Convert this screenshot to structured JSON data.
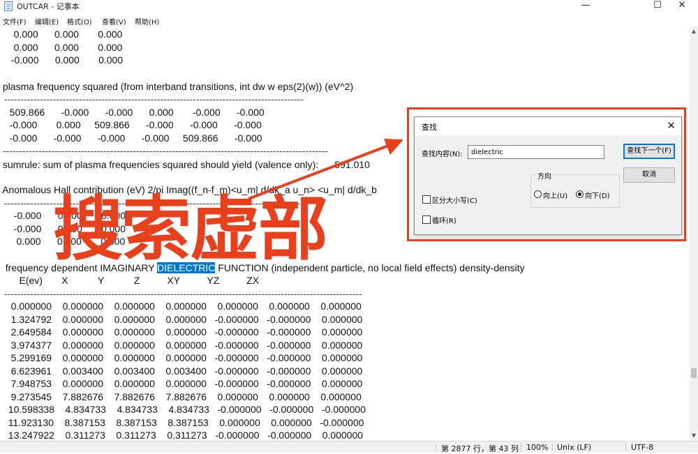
{
  "window": {
    "title": "OUTCAR - 记事本",
    "min": "—",
    "max": "☐",
    "close": "✕"
  },
  "menu": [
    "文件(F)",
    "编辑(E)",
    "格式(O)",
    "查看(V)",
    "帮助(H)"
  ],
  "lines": [
    "   0.000      0.000       0.000",
    "   0.000      0.000       0.000",
    "  -0.000      0.000       0.000",
    " plasma frequency squared (from interband transitions, int dw w eps(2)(w)) (eV^2)",
    " --------------------------------------------------------------------------------------------",
    "   509.866      -0.000      -0.000      0.000       -0.000      -0.000",
    "   -0.000       0.000     509.866      -0.000      -0.000      -0.000",
    "   -0.000      -0.000      -0.000      -0.000     509.866      -0.000",
    " ----------------------------------------------------------------------------------------------------",
    " sumrule: sum of plasma frequencies squared should yield (valence only):      591.010",
    " Anomalous Hall contribution (eV) 2/pi Imag((f_n-f_m)<u_m| d/dk_a u_n> <u_m| d/dk_b",
    " --------------------------------------------------------------------------------------------",
    "   -0.000      0.000       0.000",
    "   -0.000      0.000       0.000",
    "    0.000      0.000       0.000",
    "  frequency dependent IMAGINARY ",
    "DIELECTRIC",
    " FUNCTION (independent particle, no local field effects) density-density",
    "     E(ev)       X           Y           Z          XY          YZ          ZX",
    " --------------------------------------------------------------------------------------------------------------",
    "   0.000000    0.000000    0.000000    0.000000    0.000000    0.000000    0.000000",
    "   1.324792    0.000000    0.000000    0.000000   -0.000000   -0.000000    0.000000",
    "   2.649584    0.000000    0.000000    0.000000   -0.000000   -0.000000    0.000000",
    "   3.974377    0.000000    0.000000    0.000000   -0.000000   -0.000000    0.000000",
    "   5.299169    0.000000    0.000000    0.000000   -0.000000   -0.000000    0.000000",
    "   6.623961    0.003400    0.003400    0.003400   -0.000000   -0.000000    0.000000",
    "   7.948753    0.000000    0.000000    0.000000   -0.000000   -0.000000    0.000000",
    "   9.273545    7.882676    7.882676    7.882676    0.000000    0.000000    0.000000",
    "  10.598338    4.834733    4.834733    4.834733   -0.000000   -0.000000   -0.000000",
    "  11.923130    8.387153    8.387153    8.387153    0.000000    0.000000   -0.000000",
    "  13.247922    0.311273    0.311273    0.311273   -0.000000   -0.000000    0.000000"
  ],
  "status": {
    "pos": "第 2877 行，第 43 列",
    "zoom": "100%",
    "eol": "Unix (LF)",
    "enc": "UTF-8"
  },
  "find": {
    "title": "查找",
    "label": "查找内容(N):",
    "value": "dielectric",
    "find_next": "查找下一个(F)",
    "cancel": "取消",
    "direction": "方向",
    "up": "向上(U)",
    "down": "向下(D)",
    "match_case": "区分大小写(C)",
    "wrap": "循环(R)",
    "selected_direction": "down",
    "match_case_checked": false,
    "wrap_checked": false
  },
  "annotation": {
    "text": "搜索虚部",
    "color": "#e8401c"
  },
  "colors": {
    "selection": "#0078d7",
    "annotation_red": "#e8401c"
  }
}
